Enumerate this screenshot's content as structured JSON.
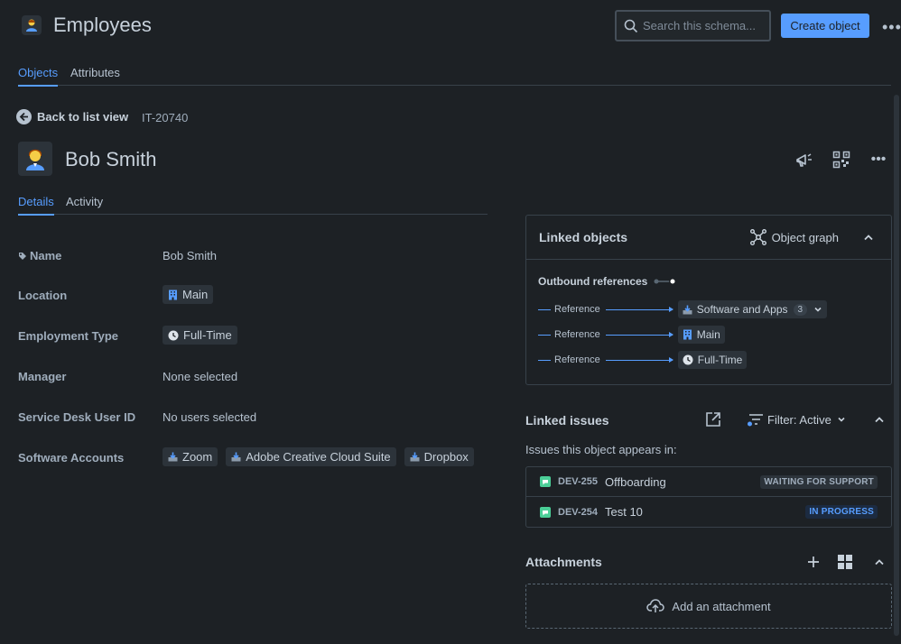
{
  "header": {
    "title": "Employees",
    "search_placeholder": "Search this schema...",
    "create_label": "Create object"
  },
  "top_tabs": [
    {
      "label": "Objects",
      "active": true
    },
    {
      "label": "Attributes",
      "active": false
    }
  ],
  "back_label": "Back to list view",
  "object_key": "IT-20740",
  "object_title": "Bob Smith",
  "detail_tabs": [
    {
      "label": "Details",
      "active": true
    },
    {
      "label": "Activity",
      "active": false
    }
  ],
  "fields": {
    "name": {
      "label": "Name",
      "value": "Bob Smith"
    },
    "location": {
      "label": "Location",
      "value": "Main",
      "icon": "building-icon"
    },
    "employment_type": {
      "label": "Employment Type",
      "value": "Full-Time",
      "icon": "clock-icon"
    },
    "manager": {
      "label": "Manager",
      "value": "None selected"
    },
    "service_desk": {
      "label": "Service Desk User ID",
      "value": "No users selected"
    },
    "software": {
      "label": "Software Accounts",
      "values": [
        "Zoom",
        "Adobe Creative Cloud Suite",
        "Dropbox"
      ],
      "icon": "download-icon"
    }
  },
  "linked_objects": {
    "title": "Linked objects",
    "graph_label": "Object graph",
    "outbound_label": "Outbound references",
    "references": [
      {
        "type": "Reference",
        "target": "Software and Apps",
        "count": "3",
        "icon": "download-icon"
      },
      {
        "type": "Reference",
        "target": "Main",
        "icon": "building-icon"
      },
      {
        "type": "Reference",
        "target": "Full-Time",
        "icon": "clock-icon"
      }
    ]
  },
  "linked_issues": {
    "title": "Linked issues",
    "filter_label": "Filter: Active",
    "subtitle": "Issues this object appears in:",
    "issues": [
      {
        "key": "DEV-255",
        "summary": "Offboarding",
        "status": "WAITING FOR SUPPORT",
        "status_color": "#9fadbc",
        "status_bg": "#2c333a"
      },
      {
        "key": "DEV-254",
        "summary": "Test 10",
        "status": "IN PROGRESS",
        "status_color": "#579dff",
        "status_bg": "#1c2b41"
      }
    ]
  },
  "attachments": {
    "title": "Attachments",
    "add_label": "Add an attachment"
  },
  "colors": {
    "background": "#1d2125",
    "accent": "#579dff",
    "issue_type": "#4bce97"
  }
}
